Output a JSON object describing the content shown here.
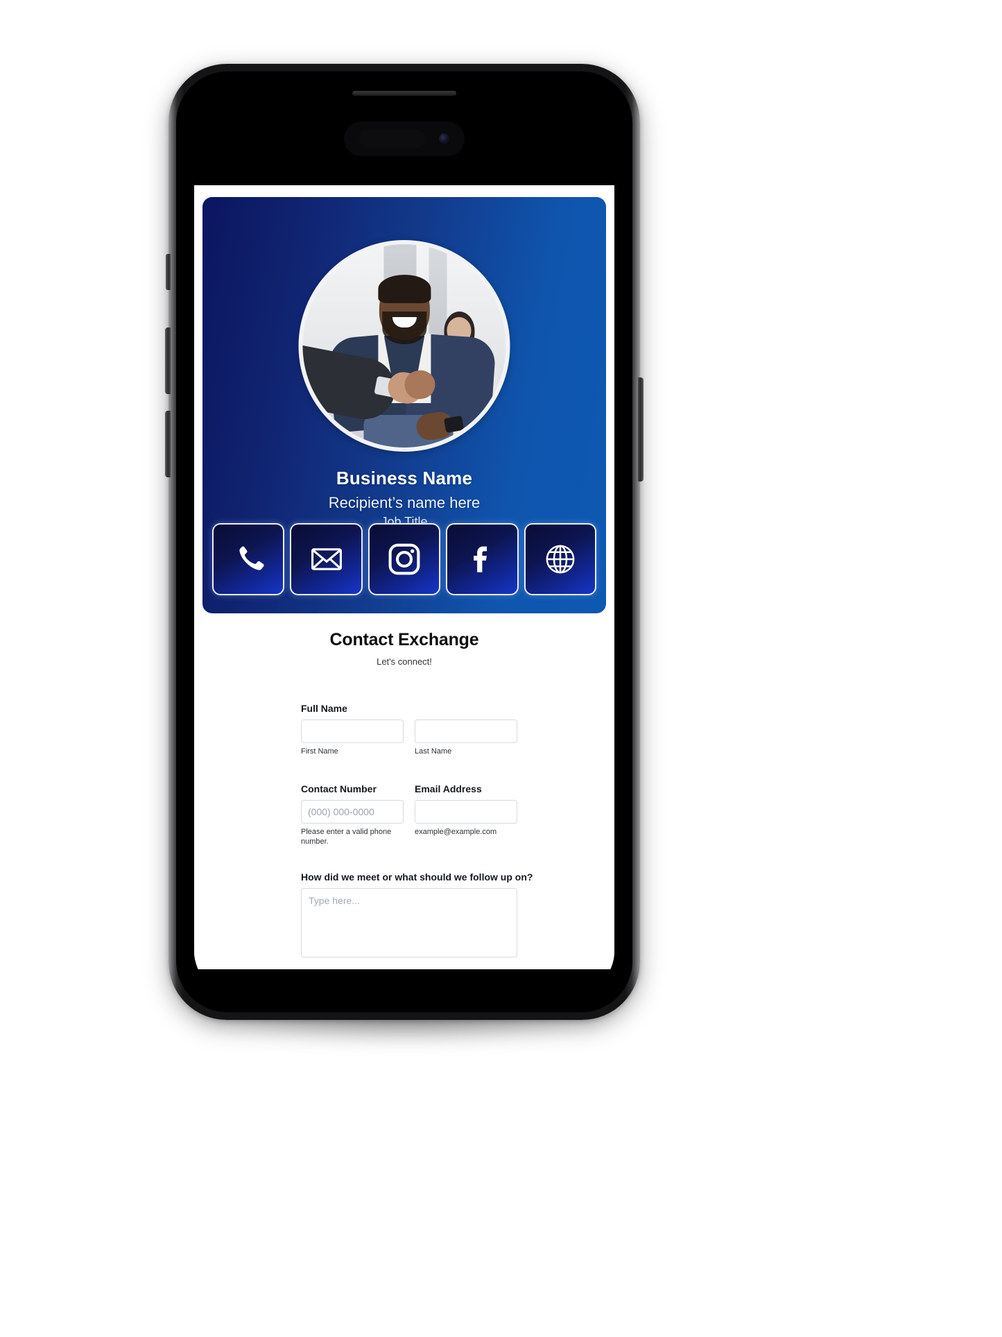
{
  "hero": {
    "business_name": "Business Name",
    "recipient_name": "Recipient’s name here",
    "job_title": "Job Title",
    "photo_alt": "businessman-handshake-photo",
    "gradient_from": "#0b1560",
    "gradient_to": "#0d59b2",
    "social_links": [
      {
        "name": "phone",
        "label": "Phone"
      },
      {
        "name": "email",
        "label": "Email"
      },
      {
        "name": "instagram",
        "label": "Instagram"
      },
      {
        "name": "facebook",
        "label": "Facebook"
      },
      {
        "name": "website",
        "label": "Website"
      }
    ]
  },
  "form": {
    "title": "Contact Exchange",
    "subtitle": "Let's connect!",
    "full_name": {
      "label": "Full Name",
      "first": {
        "value": "",
        "placeholder": "",
        "sub_label": "First Name"
      },
      "last": {
        "value": "",
        "placeholder": "",
        "sub_label": "Last Name"
      }
    },
    "contact_number": {
      "label": "Contact Number",
      "value": "",
      "placeholder": "(000) 000-0000",
      "sub_label": "Please enter a valid phone number."
    },
    "email_address": {
      "label": "Email Address",
      "value": "",
      "placeholder": "",
      "sub_label": "example@example.com"
    },
    "followup": {
      "label": "How did we meet or what should we follow up on?",
      "value": "",
      "placeholder": "Type here..."
    }
  }
}
